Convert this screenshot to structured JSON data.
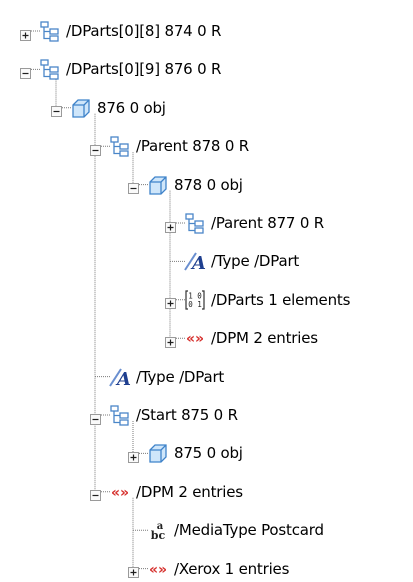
{
  "tree": {
    "nodes": [
      {
        "level": 0,
        "row": 0,
        "expander": "plus",
        "icon": "tree-ref-icon",
        "label": "/DParts[0][8] 874 0 R"
      },
      {
        "level": 0,
        "row": 1,
        "expander": "minus",
        "icon": "tree-ref-icon",
        "label": "/DParts[0][9] 876 0 R"
      },
      {
        "level": 1,
        "row": 2,
        "expander": "minus",
        "icon": "cube-icon",
        "label": "876 0 obj"
      },
      {
        "level": 2,
        "row": 3,
        "expander": "minus",
        "icon": "tree-ref-icon",
        "label": "/Parent 878 0 R"
      },
      {
        "level": 3,
        "row": 4,
        "expander": "minus",
        "icon": "cube-icon",
        "label": "878 0 obj"
      },
      {
        "level": 4,
        "row": 5,
        "expander": "plus",
        "icon": "tree-ref-icon",
        "label": "/Parent 877 0 R"
      },
      {
        "level": 4,
        "row": 6,
        "expander": "none",
        "icon": "name-a-icon",
        "label": "/Type /DPart"
      },
      {
        "level": 4,
        "row": 7,
        "expander": "plus",
        "icon": "array-icon",
        "label": "/DParts 1 elements"
      },
      {
        "level": 4,
        "row": 8,
        "expander": "plus",
        "icon": "dict-icon",
        "label": "/DPM 2 entries"
      },
      {
        "level": 2,
        "row": 9,
        "expander": "none",
        "icon": "name-a-icon",
        "label": "/Type /DPart"
      },
      {
        "level": 2,
        "row": 10,
        "expander": "minus",
        "icon": "tree-ref-icon",
        "label": "/Start 875 0 R"
      },
      {
        "level": 3,
        "row": 11,
        "expander": "plus",
        "icon": "cube-icon",
        "label": "875 0 obj"
      },
      {
        "level": 2,
        "row": 12,
        "expander": "minus",
        "icon": "dict-icon",
        "label": "/DPM 2 entries"
      },
      {
        "level": 3,
        "row": 13,
        "expander": "none",
        "icon": "string-abc-icon",
        "label": "/MediaType Postcard"
      },
      {
        "level": 3,
        "row": 14,
        "expander": "plus",
        "icon": "dict-icon",
        "label": "/Xerox 1 entries"
      }
    ],
    "array_icon_digits": [
      "1 0",
      "0 1"
    ],
    "string_icon_letters": {
      "top": "a",
      "bottom": "bc"
    },
    "dict_icon_glyph": "«»",
    "colors": {
      "connector": "#7a7a7a",
      "expander_border": "#9a9a9a",
      "ref_icon": "#4a86c8",
      "cube_front": "#cfe6fa",
      "cube_edge": "#3f83c9",
      "name_a": "#1f3f8f",
      "dict": "#d6302d"
    }
  }
}
